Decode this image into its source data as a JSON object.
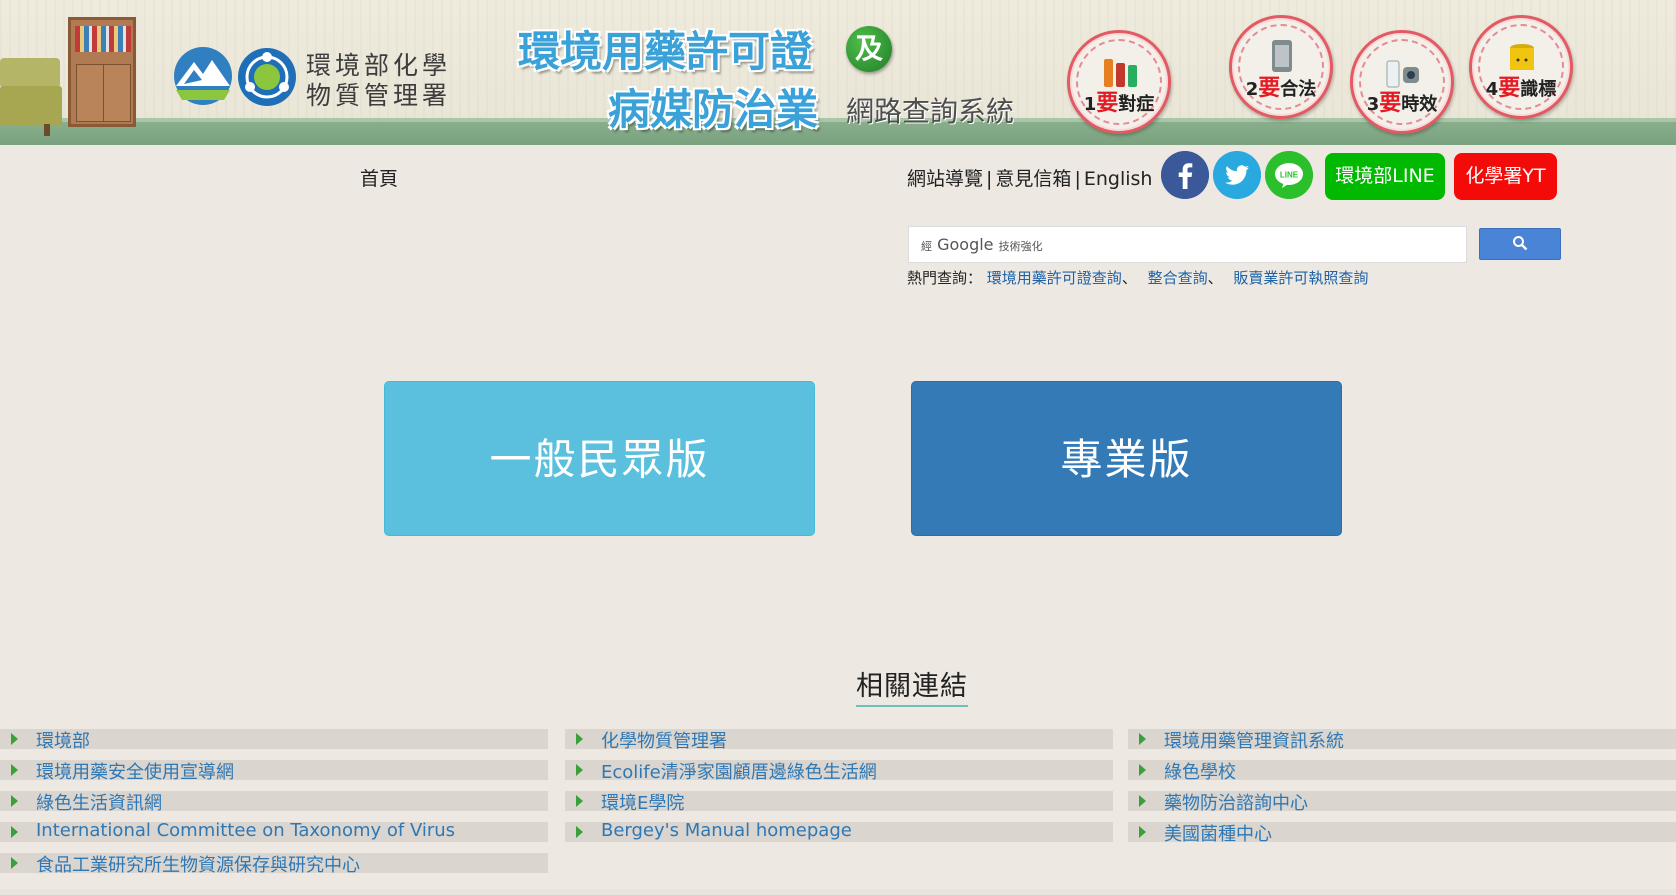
{
  "banner": {
    "org_line1": "環境部化學",
    "org_line2": "物質管理署",
    "title_line1": "環境用藥許可證",
    "and_badge": "及",
    "title_line2": "病媒防治業",
    "subtitle": "網路查詢系統",
    "badges": [
      {
        "num": "1",
        "word": "要",
        "rest": "對症"
      },
      {
        "num": "2",
        "word": "要",
        "rest": "合法"
      },
      {
        "num": "3",
        "word": "要",
        "rest": "時效"
      },
      {
        "num": "4",
        "word": "要",
        "rest": "識標"
      }
    ]
  },
  "nav": {
    "home": "首頁",
    "sitemap": "網站導覽",
    "feedback": "意見信箱",
    "english": "English",
    "sep": "|",
    "line_label": "環境部LINE",
    "yt_label": "化學署YT",
    "line_icon_text": "LINE"
  },
  "search": {
    "placeholder_brand": "Google",
    "placeholder_prefix": "經",
    "placeholder_suffix": "技術強化",
    "hot_label": "熱門查詢：",
    "hot_links": [
      "環境用藥許可證查詢",
      "整合查詢",
      "販賣業許可執照查詢"
    ],
    "comma": "、"
  },
  "main": {
    "general_button": "一般民眾版",
    "pro_button": "專業版"
  },
  "related": {
    "title": "相關連結",
    "columns": [
      [
        "環境部",
        "環境用藥安全使用宣導網",
        "綠色生活資訊網",
        "International Committee on Taxonomy of Virus",
        "食品工業研究所生物資源保存與研究中心"
      ],
      [
        "化學物質管理署",
        "Ecolife清淨家園顧厝邊綠色生活網",
        "環境E學院",
        "Bergey's Manual homepage"
      ],
      [
        "環境用藥管理資訊系統",
        "綠色學校",
        "藥物防治諮詢中心",
        "美國菌種中心"
      ]
    ]
  },
  "colors": {
    "background": "#ede8e2",
    "general_button": "#5ac0de",
    "pro_button": "#337ab7",
    "link": "#2e78b5",
    "line_green": "#00b900",
    "yt_red": "#f50a0a",
    "facebook": "#3b5998",
    "twitter": "#2aa9e0",
    "search_button": "#4a84d6"
  },
  "icons": {
    "facebook": "facebook-icon",
    "twitter": "twitter-icon",
    "line": "line-icon",
    "search": "search-icon",
    "bullet": "triangle-right-icon"
  }
}
